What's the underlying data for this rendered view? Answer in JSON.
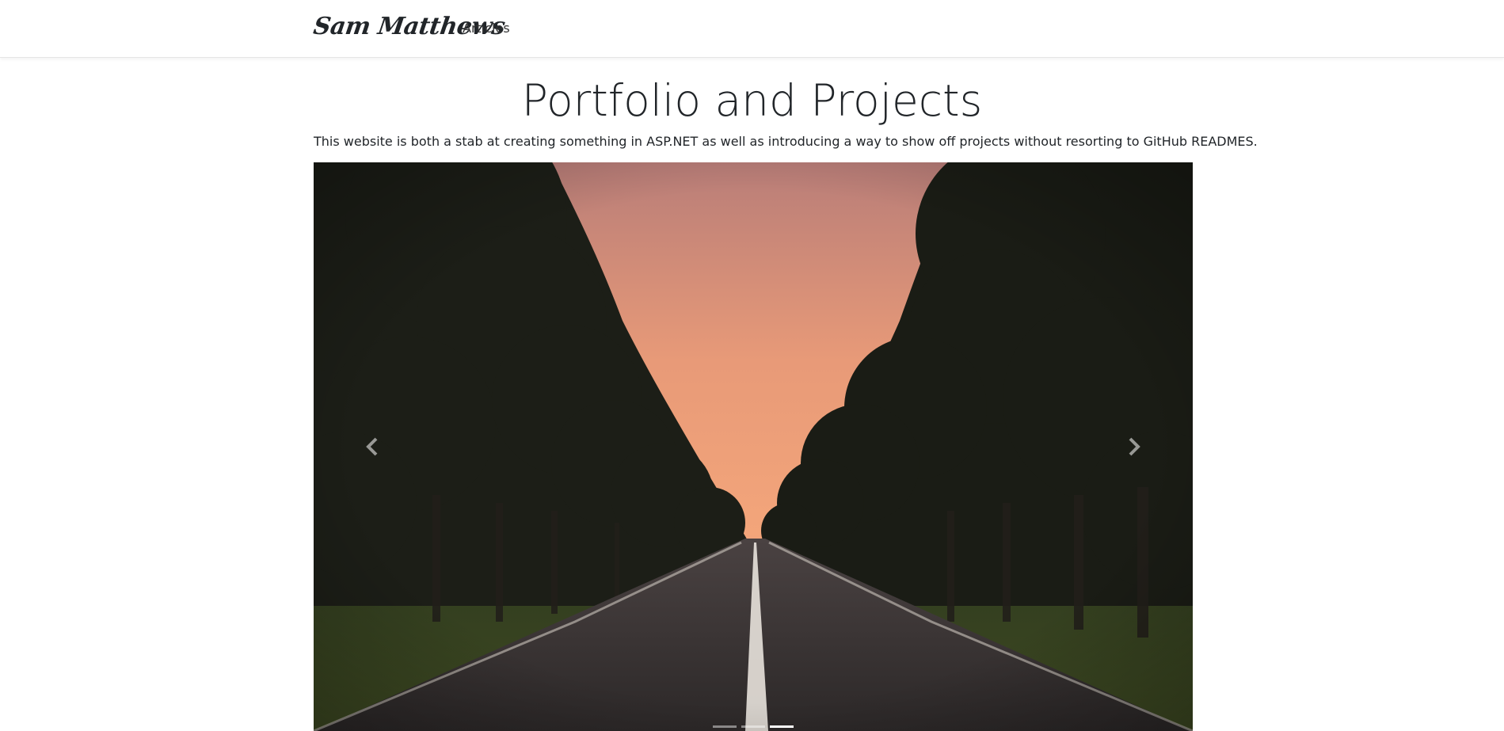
{
  "navbar": {
    "brand": "Sam Matthews",
    "links": [
      {
        "label": "Articles"
      }
    ]
  },
  "main": {
    "title": "Portfolio and Projects",
    "intro": "This website is both a stab at creating something in ASP.NET as well as introducing a way to show off projects without resorting to GitHub READMES."
  },
  "carousel": {
    "slide_count": 3,
    "active_index": 2,
    "prev_icon": "chevron-left-icon",
    "next_icon": "chevron-right-icon",
    "image_subject": "tree-lined road at sunset"
  },
  "colors": {
    "sky_top": "#c7867a",
    "sky_glow": "#f0a07a",
    "foliage": "#1f2119",
    "road": "#3b3636",
    "road_line": "#e8e2dc"
  }
}
